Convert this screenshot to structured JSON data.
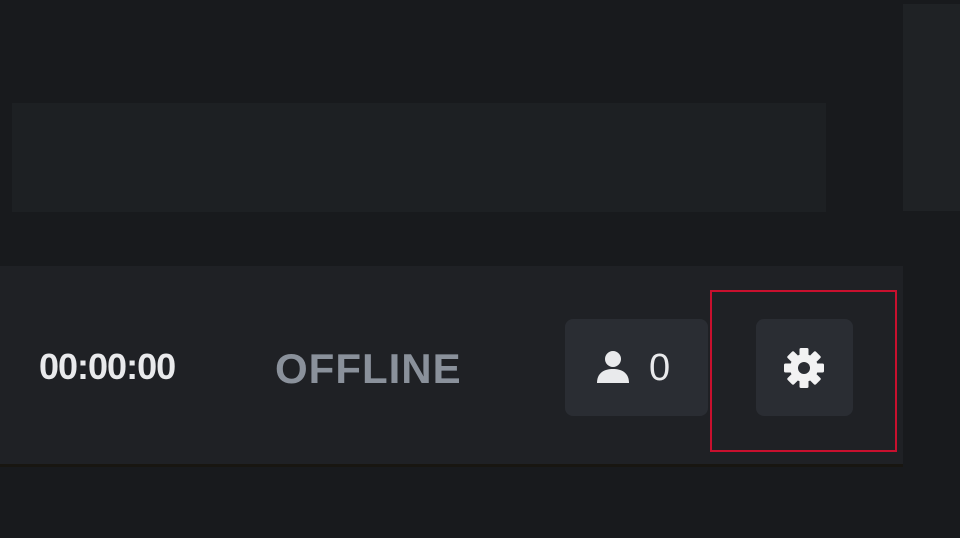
{
  "status_bar": {
    "timer": "00:00:00",
    "status": "OFFLINE",
    "viewer_count": "0"
  },
  "icons": {
    "viewers": "user-icon",
    "settings": "gear-icon"
  },
  "colors": {
    "highlight": "#c8102e",
    "status_text": "#8a919b",
    "button_bg": "#2a2d33"
  }
}
